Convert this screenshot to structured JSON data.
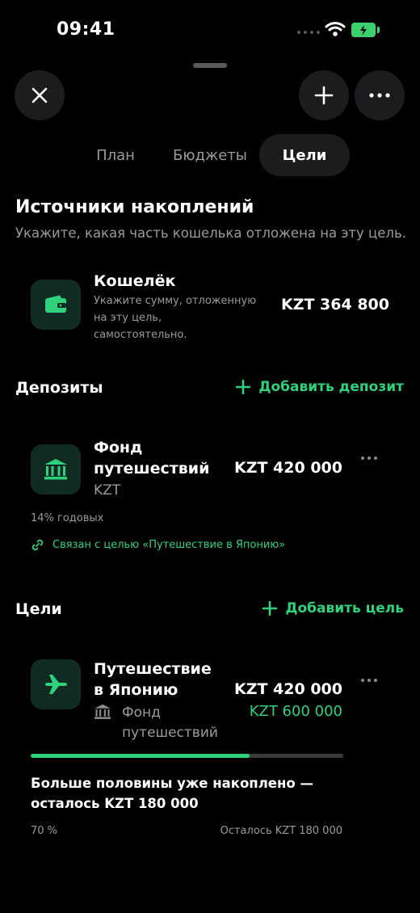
{
  "status_bar": {
    "time": "09:41"
  },
  "tabs": [
    {
      "label": "План",
      "active": false
    },
    {
      "label": "Бюджеты",
      "active": false
    },
    {
      "label": "Цели",
      "active": true
    }
  ],
  "sources": {
    "title": "Источники накоплений",
    "subtitle": "Укажите, какая часть кошелька отложена на эту цель.",
    "wallet": {
      "name": "Кошелёк",
      "description": [
        "Укажите сумму, отложенную",
        "на эту цель,",
        "самостоятельно."
      ],
      "amount": "KZT 364 800"
    }
  },
  "deposits": {
    "title": "Депозиты",
    "add_label": "Добавить депозит",
    "items": [
      {
        "name_lines": [
          "Фонд",
          "путешествий"
        ],
        "currency": "KZT",
        "amount": "KZT 420 000",
        "rate": "14% годовых",
        "linked": "Связан с целью «Путешествие в Японию»"
      }
    ]
  },
  "goals": {
    "title": "Цели",
    "add_label": "Добавить цель",
    "items": [
      {
        "name_lines": [
          "Путешествие",
          "в Японию"
        ],
        "source_lines": [
          "Фонд",
          "путешествий"
        ],
        "saved": "KZT 420 000",
        "target": "KZT 600 000",
        "progress": 0.7,
        "message_lines": [
          "Больше половины уже накоплено —",
          "осталось KZT 180 000"
        ],
        "percent_label": "70 %",
        "remaining_label": "Осталось KZT 180 000"
      }
    ]
  },
  "colors": {
    "accent": "#2fd17d",
    "background": "#000000",
    "surface": "#1c1c1e",
    "tile": "#0f2b22"
  }
}
